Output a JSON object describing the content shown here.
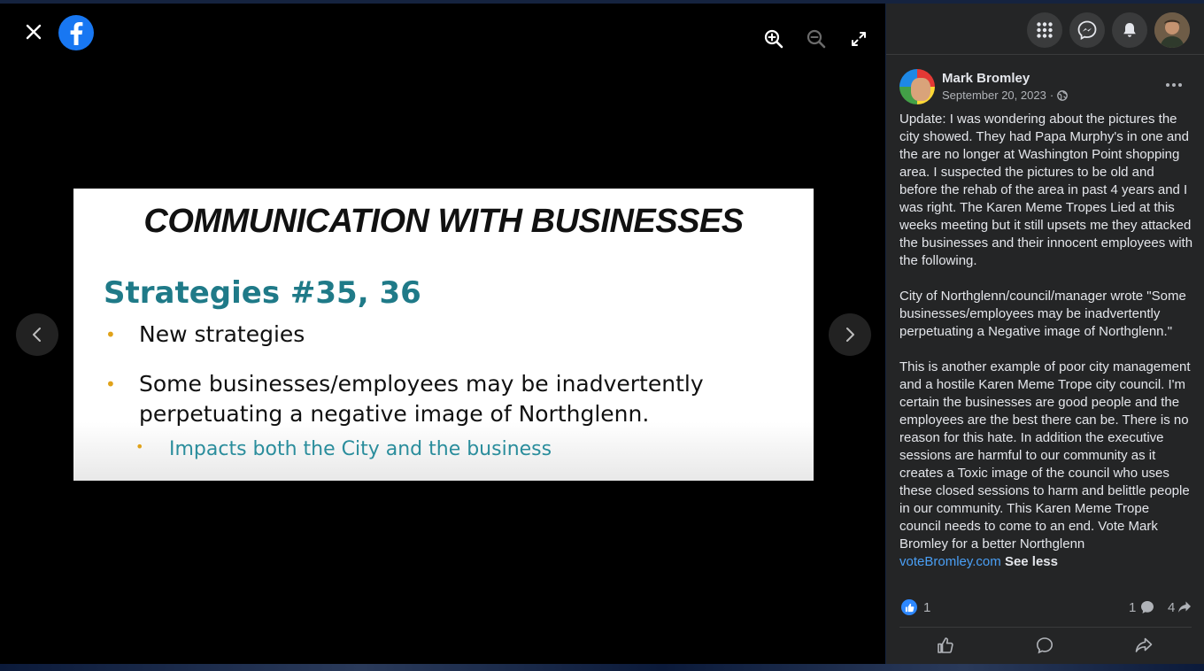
{
  "viewer": {
    "slide": {
      "title": "COMMUNICATION WITH BUSINESSES",
      "heading": "Strategies #35, 36",
      "bullets": [
        "New strategies",
        "Some businesses/employees may be inadvertently perpetuating a negative image of Northglenn."
      ],
      "sub_bullet": "Impacts both the City and the business"
    },
    "icons": {
      "close": "close-icon",
      "logo": "facebook-logo",
      "zoom_in": "zoom-in-icon",
      "zoom_out": "zoom-out-icon",
      "fullscreen": "fullscreen-icon",
      "prev": "chevron-left-icon",
      "next": "chevron-right-icon"
    }
  },
  "post": {
    "author": "Mark Bromley",
    "date": "September 20, 2023",
    "date_separator": "·",
    "privacy_icon": "globe-icon",
    "paragraphs": [
      "Update: I was wondering about the pictures the city showed. They had Papa Murphy's in one and the are no longer at Washington Point shopping area. I suspected the pictures to be old and before the rehab of the area in past 4 years and I was right. The Karen Meme Tropes Lied at this weeks meeting but it still upsets me they attacked the businesses and their innocent employees with the following.",
      "City of Northglenn/council/manager wrote \"Some businesses/employees may be inadvertently perpetuating a Negative image of Northglenn.\"",
      "This is another example of poor city management and a hostile Karen Meme Trope city council. I'm certain the businesses are good people and the employees are the best there can be. There is no reason for this hate. In addition the executive sessions are harmful to our community as it creates a Toxic image of the council who uses these closed sessions to harm and belittle people in our community. This Karen Meme Trope council needs to come to an end. Vote Mark Bromley for a better Northglenn"
    ],
    "link": "voteBromley.com",
    "see_less": "See less",
    "like_count": "1",
    "comment_count": "1",
    "share_count": "4"
  },
  "colors": {
    "facebook_blue": "#1877f2",
    "sidebar_bg": "#242526",
    "link": "#4a9ff5",
    "slide_heading": "#1f7a88",
    "bullet_dot": "#e0a21a"
  }
}
